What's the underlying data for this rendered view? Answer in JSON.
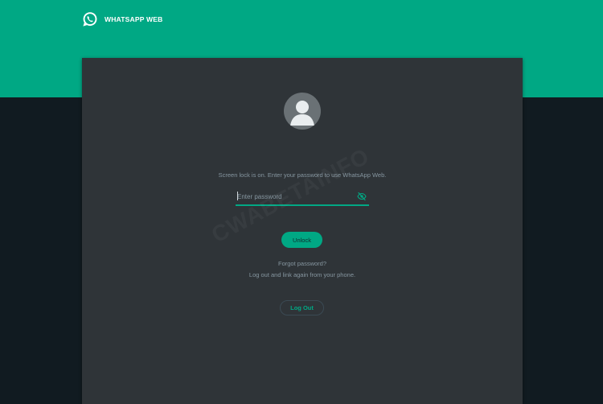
{
  "app": {
    "title": "WHATSAPP WEB",
    "brand_color": "#00a884",
    "logo_icon": "whatsapp-logo-icon"
  },
  "lock_screen": {
    "avatar_icon": "default-avatar-icon",
    "message": "Screen lock is on. Enter your password to use WhatsApp Web.",
    "password": {
      "value": "",
      "placeholder": "Enter password",
      "toggle_icon": "eye-off-icon"
    },
    "unlock_label": "Unlock",
    "forgot_label": "Forgot password?",
    "logout_hint": "Log out and link again from your phone.",
    "logout_label": "Log Out"
  },
  "watermark": "CWABETAINFO"
}
